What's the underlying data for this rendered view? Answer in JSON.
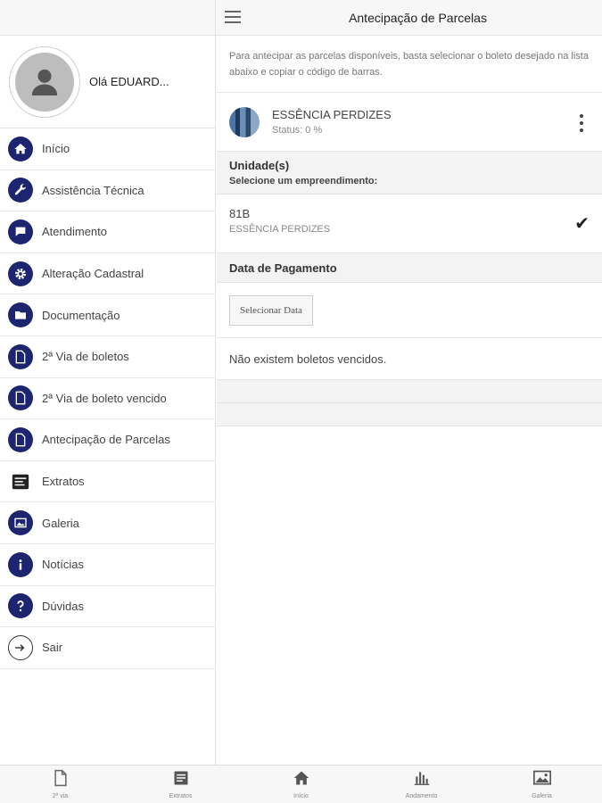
{
  "header": {
    "title": "Antecipação de Parcelas"
  },
  "profile": {
    "greeting": "Olá EDUARD..."
  },
  "sidebar": {
    "items": [
      {
        "label": "Início",
        "icon": "home-icon"
      },
      {
        "label": "Assistência Técnica",
        "icon": "wrench-icon"
      },
      {
        "label": "Atendimento",
        "icon": "chat-icon"
      },
      {
        "label": "Alteração Cadastral",
        "icon": "gear-icon"
      },
      {
        "label": "Documentação",
        "icon": "folder-icon"
      },
      {
        "label": "2ª Via de boletos",
        "icon": "document-icon"
      },
      {
        "label": "2ª Via de boleto vencido",
        "icon": "document-icon"
      },
      {
        "label": "Antecipação de Parcelas",
        "icon": "document-icon"
      },
      {
        "label": "Extratos",
        "icon": "statement-icon"
      },
      {
        "label": "Galeria",
        "icon": "image-icon"
      },
      {
        "label": "Notícias",
        "icon": "info-icon"
      },
      {
        "label": "Dúvidas",
        "icon": "question-icon"
      },
      {
        "label": "Sair",
        "icon": "logout-icon"
      }
    ]
  },
  "main": {
    "instructions": "Para antecipar as parcelas disponíveis, basta selecionar o boleto desejado na lista abaixo e copiar o código de barras.",
    "project": {
      "name": "ESSÊNCIA PERDIZES",
      "status": "Status: 0 %"
    },
    "units": {
      "title": "Unidade(s)",
      "subtitle": "Selecione um empreendimento:"
    },
    "selected_unit": {
      "code": "81B",
      "project": "ESSÊNCIA PERDIZES"
    },
    "payment": {
      "title": "Data de Pagamento",
      "button": "Selecionar Data"
    },
    "empty_message": "Não existem boletos vencidos."
  },
  "bottom_nav": [
    {
      "label": "2ª via",
      "icon": "document-icon"
    },
    {
      "label": "Extratos",
      "icon": "list-icon"
    },
    {
      "label": "Início",
      "icon": "home-icon"
    },
    {
      "label": "Andamento",
      "icon": "bar-chart-icon"
    },
    {
      "label": "Galeria",
      "icon": "image-icon"
    }
  ],
  "colors": {
    "accent": "#1d2570",
    "background": "#ffffff",
    "band": "#f3f3f3"
  }
}
